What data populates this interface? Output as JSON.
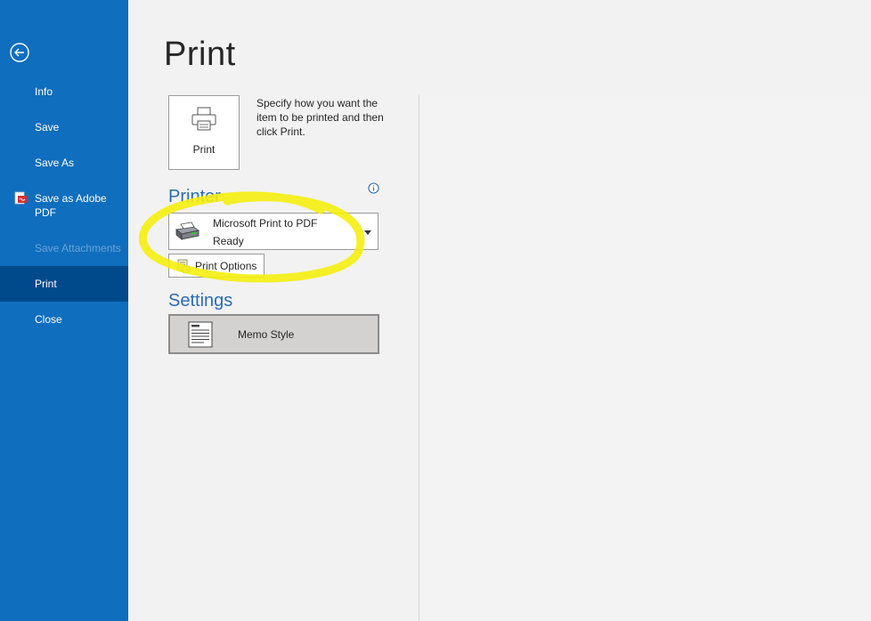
{
  "sidebar": {
    "back_label": "Back",
    "items": [
      {
        "label": "Info"
      },
      {
        "label": "Save"
      },
      {
        "label": "Save As"
      },
      {
        "label": "Save as Adobe PDF"
      },
      {
        "label": "Save Attachments"
      },
      {
        "label": "Print"
      },
      {
        "label": "Close"
      }
    ],
    "active_item": "Print",
    "background_color": "#106ebe",
    "active_color": "#004a8b"
  },
  "main": {
    "title": "Print",
    "print_button_label": "Print",
    "print_description": "Specify how you want the item to be printed and then click Print.",
    "printer_heading": "Printer",
    "printer": {
      "name": "Microsoft Print to PDF",
      "status": "Ready"
    },
    "print_options_label": "Print Options",
    "settings_heading": "Settings",
    "style": {
      "name": "Memo Style"
    },
    "heading_color": "#2b6cb3"
  },
  "annotation": {
    "color": "#f5ee0f",
    "shape": "hand-drawn ellipse around printer selector"
  }
}
